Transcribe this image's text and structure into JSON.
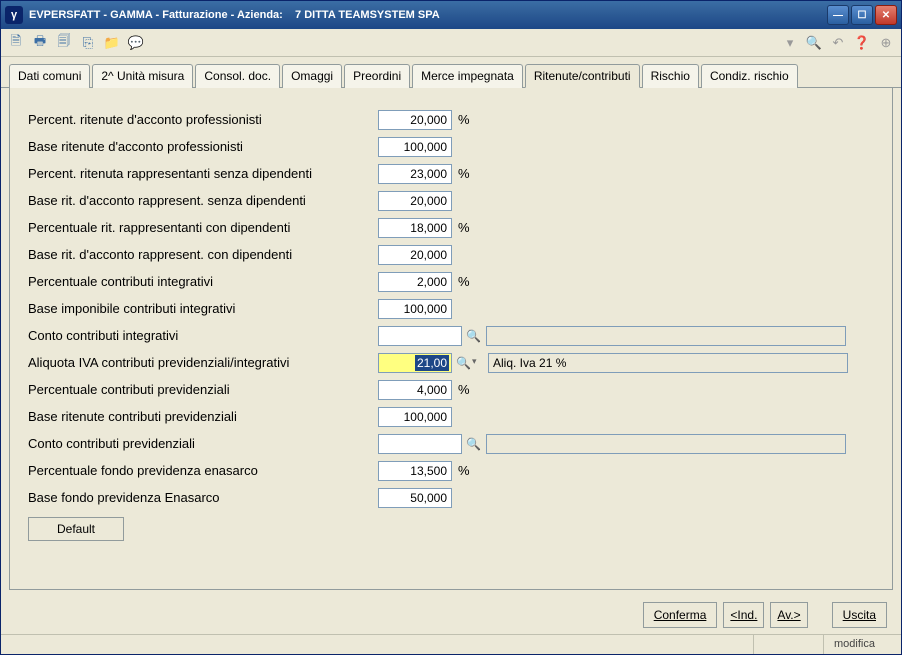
{
  "titlebar": {
    "text": "EVPERSFATT - GAMMA - Fatturazione - Azienda:    7 DITTA TEAMSYSTEM SPA",
    "icon_label": "γ"
  },
  "tabs": [
    "Dati comuni",
    "2^ Unità misura",
    "Consol. doc.",
    "Omaggi",
    "Preordini",
    "Merce impegnata",
    "Ritenute/contributi",
    "Rischio",
    "Condiz. rischio"
  ],
  "active_tab_index": 6,
  "fields": {
    "perc_rit_prof": {
      "label": "Percent. ritenute d'acconto professionisti",
      "value": "20,000",
      "suffix": "%"
    },
    "base_rit_prof": {
      "label": "Base ritenute d'acconto professionisti",
      "value": "100,000"
    },
    "perc_rit_rapp_nd": {
      "label": "Percent. ritenuta rappresentanti senza dipendenti",
      "value": "23,000",
      "suffix": "%"
    },
    "base_rit_rapp_nd": {
      "label": "Base rit. d'acconto rappresent. senza dipendenti",
      "value": "20,000"
    },
    "perc_rit_rapp_cd": {
      "label": "Percentuale rit. rappresentanti con dipendenti",
      "value": "18,000",
      "suffix": "%"
    },
    "base_rit_rapp_cd": {
      "label": "Base rit. d'acconto rappresent. con dipendenti",
      "value": "20,000"
    },
    "perc_contr_int": {
      "label": "Percentuale contributi integrativi",
      "value": "2,000",
      "suffix": "%"
    },
    "base_imp_contr_int": {
      "label": "Base imponibile contributi integrativi",
      "value": "100,000"
    },
    "conto_contr_int": {
      "label": "Conto contributi integrativi",
      "value": "",
      "desc": ""
    },
    "aliq_iva": {
      "label": "Aliquota IVA contributi previdenziali/integrativi",
      "value": "21,00",
      "desc": "Aliq. Iva 21 %"
    },
    "perc_contr_prev": {
      "label": "Percentuale contributi previdenziali",
      "value": "4,000",
      "suffix": "%"
    },
    "base_rit_prev": {
      "label": "Base ritenute contributi previdenziali",
      "value": "100,000"
    },
    "conto_contr_prev": {
      "label": "Conto contributi previdenziali",
      "value": "",
      "desc": ""
    },
    "perc_enasarco": {
      "label": "Percentuale fondo previdenza enasarco",
      "value": "13,500",
      "suffix": "%"
    },
    "base_enasarco": {
      "label": "Base fondo previdenza Enasarco",
      "value": "50,000"
    }
  },
  "buttons": {
    "default": "Default",
    "conferma": "Conferma",
    "ind": "<Ind.",
    "av": "Av.>",
    "uscita": "Uscita"
  },
  "status": "modifica"
}
